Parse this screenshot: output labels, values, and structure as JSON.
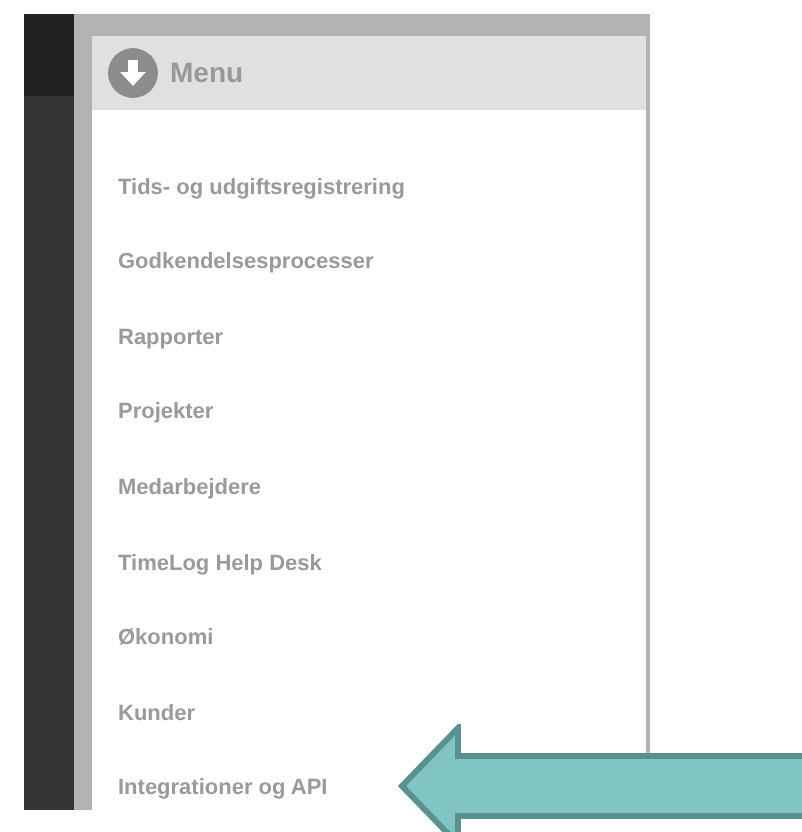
{
  "menu": {
    "title": "Menu",
    "items": [
      {
        "label": "Tids- og udgiftsregistrering"
      },
      {
        "label": "Godkendelsesprocesser"
      },
      {
        "label": "Rapporter"
      },
      {
        "label": "Projekter"
      },
      {
        "label": "Medarbejdere"
      },
      {
        "label": "TimeLog Help Desk"
      },
      {
        "label": "Økonomi"
      },
      {
        "label": "Kunder"
      },
      {
        "label": "Integrationer og API"
      }
    ]
  }
}
